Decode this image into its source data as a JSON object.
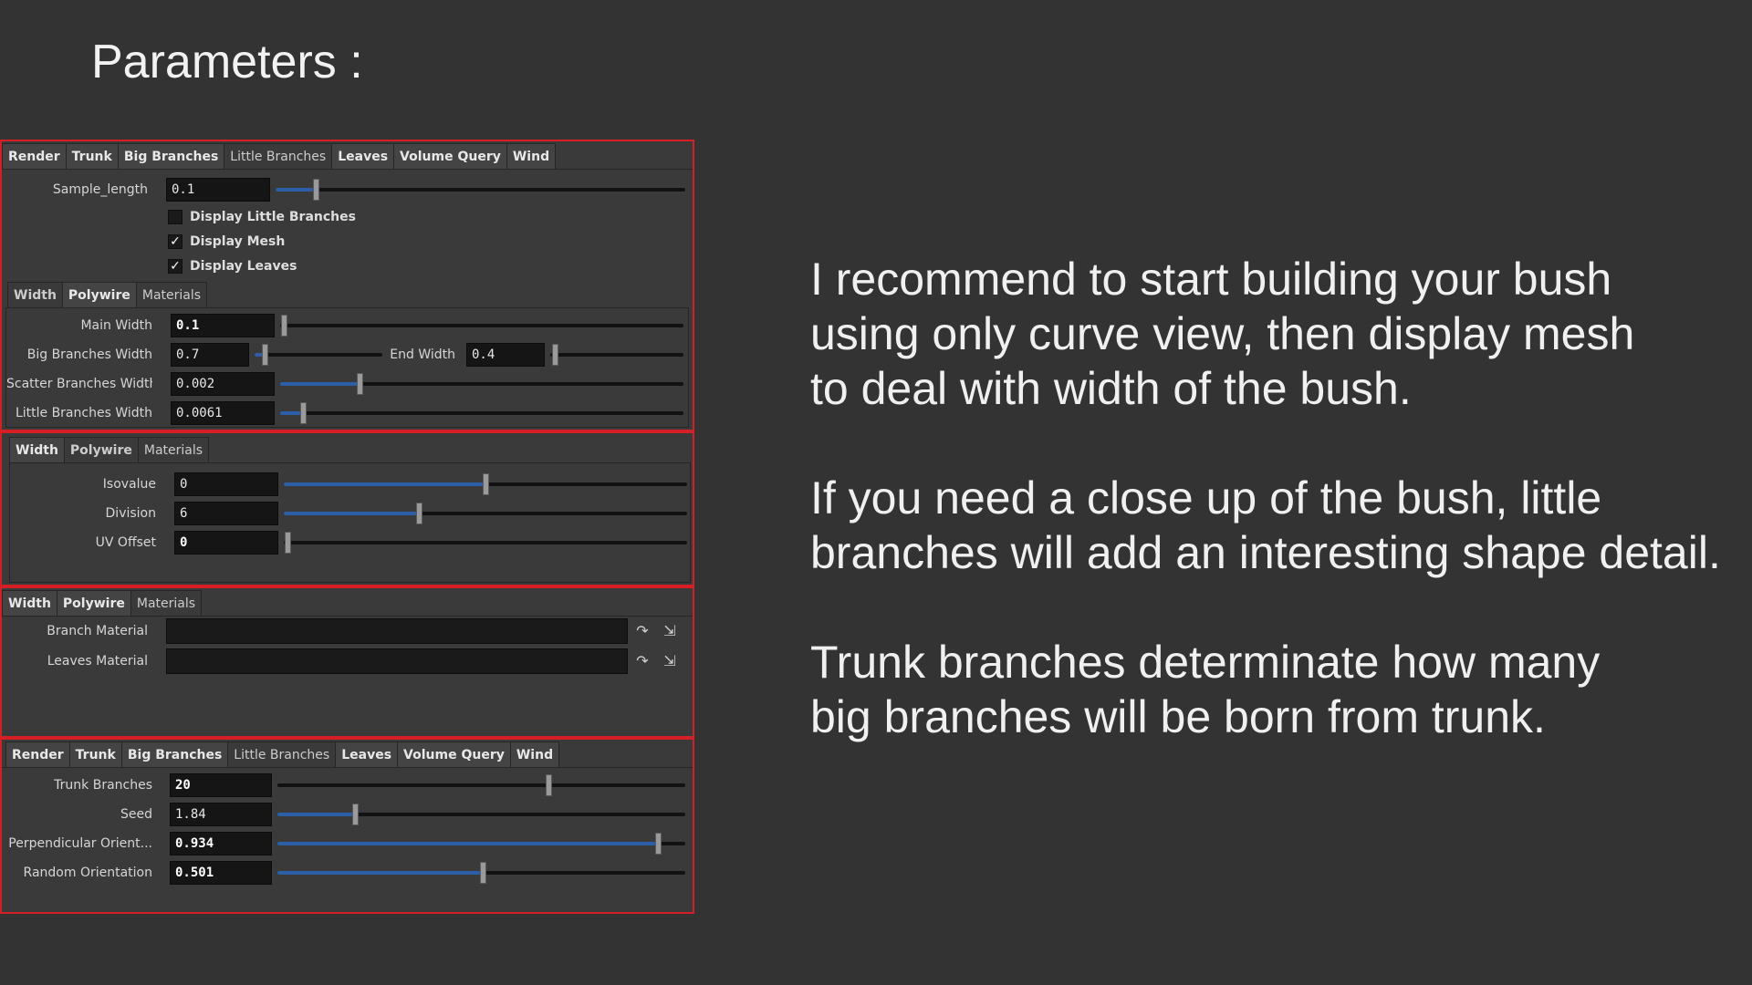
{
  "title": "Parameters :",
  "explanation": {
    "p1": [
      "I recommend to start building your bush",
      "using only curve view, then display mesh",
      "to deal with width of the bush."
    ],
    "p2": [
      "If you need a close up of the bush, little",
      "branches will add an interesting shape detail."
    ],
    "p3": [
      "Trunk branches determinate how many",
      "big branches will be born from trunk."
    ]
  },
  "main_tabs": [
    "Render",
    "Trunk",
    "Big Branches",
    "Little Branches",
    "Leaves",
    "Volume Query",
    "Wind"
  ],
  "sub_tabs": [
    "Width",
    "Polywire",
    "Materials"
  ],
  "render": {
    "sample_length_label": "Sample_length",
    "sample_length_value": "0.1",
    "sample_length_pos": 0.1,
    "display_little_branches": "Display Little Branches",
    "display_mesh": "Display Mesh",
    "display_leaves": "Display Leaves",
    "check_mark": "✓"
  },
  "width": {
    "main_width_label": "Main Width",
    "main_width_value": "0.1",
    "big_branches_width_label": "Big Branches Width",
    "big_branches_width_value": "0.7",
    "end_width_label": "End Width",
    "end_width_value": "0.4",
    "scatter_branches_width_label": "Scatter Branches Width",
    "scatter_branches_width_value": "0.002",
    "little_branches_width_label": "Little Branches Width",
    "little_branches_width_value": "0.0061"
  },
  "polywire": {
    "isovalue_label": "Isovalue",
    "isovalue_value": "0",
    "division_label": "Division",
    "division_value": "6",
    "uv_offset_label": "UV Offset",
    "uv_offset_value": "0"
  },
  "materials": {
    "branch_material_label": "Branch Material",
    "leaves_material_label": "Leaves Material"
  },
  "trunk": {
    "trunk_branches_label": "Trunk Branches",
    "trunk_branches_value": "20",
    "seed_label": "Seed",
    "seed_value": "1.84",
    "perpendicular_label": "Perpendicular Orient...",
    "perpendicular_value": "0.934",
    "random_orientation_label": "Random Orientation",
    "random_orientation_value": "0.501"
  },
  "colors": {
    "background": "#333333",
    "highlight_border": "#d51f24",
    "slider_fill": "#2d5fa8"
  }
}
